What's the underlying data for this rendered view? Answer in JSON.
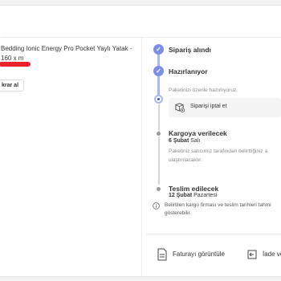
{
  "product": {
    "name": "Bedding Ionic Energy Pro Pocket Yaylı Yatak - 160 x m",
    "reorder_label": "krar al"
  },
  "timeline": {
    "steps": [
      {
        "title": "Sipariş alındı",
        "status": "done"
      },
      {
        "title": "Hazırlanıyor",
        "status": "current",
        "description": "Paketinizi özenle hazırlıyoruz."
      },
      {
        "title": "Kargoya verilecek",
        "status": "upcoming",
        "date_strong": "6 Şubat",
        "date_day": "Salı",
        "description": "Paketiniz satıcımız tarafından belirttiğiniz a ulaştırılacaktır."
      },
      {
        "title": "Teslim edilecek",
        "status": "upcoming",
        "date_strong": "12 Şubat",
        "date_day": "Pazartesi"
      }
    ],
    "cancel_label": "Siparişi iptal et"
  },
  "info_note": "Belirtilen kargo firması ve teslim tarihleri tahmi gösterebilir.",
  "actions": {
    "invoice_label": "Faturayı görüntüle",
    "return_label": "İade ve"
  },
  "colors": {
    "brand": "#f27a1a",
    "timeline_active": "#7c8fe6",
    "price_highlight": "#e8232b"
  }
}
